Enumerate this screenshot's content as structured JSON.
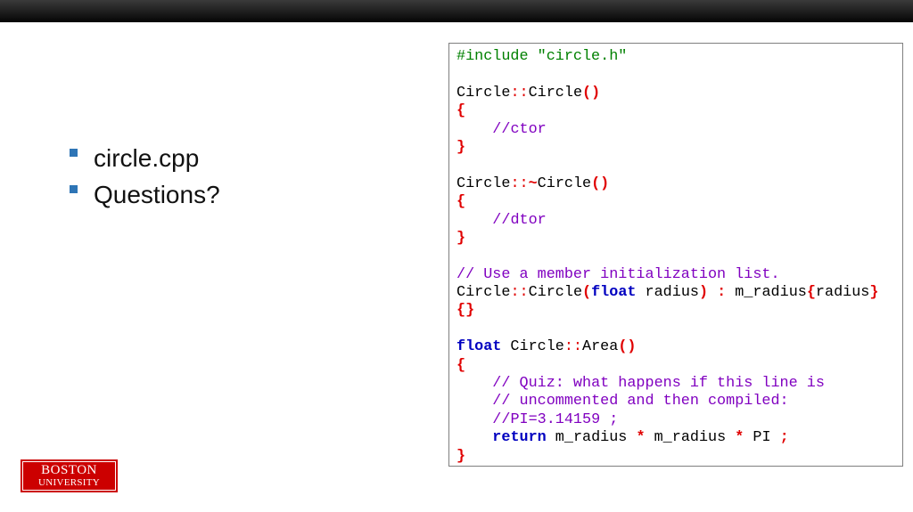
{
  "bullets": [
    {
      "text": "circle.cpp"
    },
    {
      "text": "Questions?"
    }
  ],
  "code_lines": [
    [
      {
        "t": "#include \"circle.h\"",
        "c": "pre"
      }
    ],
    [],
    [
      {
        "t": "Circle",
        "c": "txt"
      },
      {
        "t": "::",
        "c": "sc"
      },
      {
        "t": "Circle",
        "c": "txt"
      },
      {
        "t": "()",
        "c": "op"
      }
    ],
    [
      {
        "t": "{",
        "c": "op"
      }
    ],
    [
      {
        "t": "    ",
        "c": "txt"
      },
      {
        "t": "//ctor",
        "c": "cmt"
      }
    ],
    [
      {
        "t": "}",
        "c": "op"
      }
    ],
    [],
    [
      {
        "t": "Circle",
        "c": "txt"
      },
      {
        "t": "::",
        "c": "sc"
      },
      {
        "t": "~",
        "c": "op"
      },
      {
        "t": "Circle",
        "c": "txt"
      },
      {
        "t": "()",
        "c": "op"
      }
    ],
    [
      {
        "t": "{",
        "c": "op"
      }
    ],
    [
      {
        "t": "    ",
        "c": "txt"
      },
      {
        "t": "//dtor",
        "c": "cmt"
      }
    ],
    [
      {
        "t": "}",
        "c": "op"
      }
    ],
    [],
    [
      {
        "t": "// Use a member initialization list.",
        "c": "cmt"
      }
    ],
    [
      {
        "t": "Circle",
        "c": "txt"
      },
      {
        "t": "::",
        "c": "sc"
      },
      {
        "t": "Circle",
        "c": "txt"
      },
      {
        "t": "(",
        "c": "op"
      },
      {
        "t": "float",
        "c": "kw"
      },
      {
        "t": " radius",
        "c": "txt"
      },
      {
        "t": ")",
        "c": "op"
      },
      {
        "t": " ",
        "c": "txt"
      },
      {
        "t": ":",
        "c": "op"
      },
      {
        "t": " m_radius",
        "c": "txt"
      },
      {
        "t": "{",
        "c": "op"
      },
      {
        "t": "radius",
        "c": "txt"
      },
      {
        "t": "}",
        "c": "op"
      }
    ],
    [
      {
        "t": "{}",
        "c": "op"
      }
    ],
    [],
    [
      {
        "t": "float",
        "c": "kw"
      },
      {
        "t": " Circle",
        "c": "txt"
      },
      {
        "t": "::",
        "c": "sc"
      },
      {
        "t": "Area",
        "c": "txt"
      },
      {
        "t": "()",
        "c": "op"
      }
    ],
    [
      {
        "t": "{",
        "c": "op"
      }
    ],
    [
      {
        "t": "    ",
        "c": "txt"
      },
      {
        "t": "// Quiz: what happens if this line is",
        "c": "cmt"
      }
    ],
    [
      {
        "t": "    ",
        "c": "txt"
      },
      {
        "t": "// uncommented and then compiled:",
        "c": "cmt"
      }
    ],
    [
      {
        "t": "    ",
        "c": "txt"
      },
      {
        "t": "//PI=3.14159 ;",
        "c": "cmt"
      }
    ],
    [
      {
        "t": "    ",
        "c": "txt"
      },
      {
        "t": "return",
        "c": "kw"
      },
      {
        "t": " m_radius ",
        "c": "txt"
      },
      {
        "t": "*",
        "c": "op"
      },
      {
        "t": " m_radius ",
        "c": "txt"
      },
      {
        "t": "*",
        "c": "op"
      },
      {
        "t": " PI ",
        "c": "txt"
      },
      {
        "t": ";",
        "c": "op"
      }
    ],
    [
      {
        "t": "}",
        "c": "op"
      }
    ]
  ],
  "logo": {
    "line1": "BOSTON",
    "line2": "UNIVERSITY"
  },
  "colors": {
    "bullet": "#2e75b6",
    "logo_bg": "#cc0000",
    "preprocessor": "#008000",
    "comment": "#8000c0",
    "keyword": "#0000c0",
    "operator": "#e00000"
  }
}
